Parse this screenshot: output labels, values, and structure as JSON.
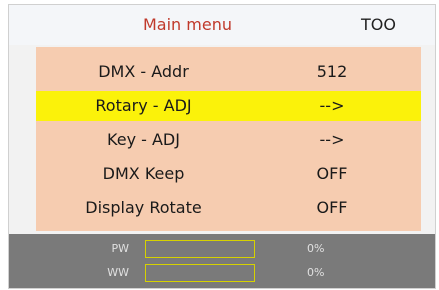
{
  "header": {
    "title": "Main menu",
    "model": "TOO",
    "title_color": "#c0392b"
  },
  "menu": {
    "background": "#f6ccb0",
    "selected_color": "#fbf20a",
    "selected_index": 1,
    "items": [
      {
        "label": "DMX - Addr",
        "value": "512"
      },
      {
        "label": "Rotary - ADJ",
        "value": "-->"
      },
      {
        "label": "Key - ADJ",
        "value": "-->"
      },
      {
        "label": "DMX Keep",
        "value": "OFF"
      },
      {
        "label": "Display Rotate",
        "value": "OFF"
      }
    ]
  },
  "status": {
    "bars": [
      {
        "label": "PW",
        "value": "0%",
        "level": 0
      },
      {
        "label": "WW",
        "value": "0%",
        "level": 0
      }
    ],
    "bar_color": "#d6d200"
  }
}
